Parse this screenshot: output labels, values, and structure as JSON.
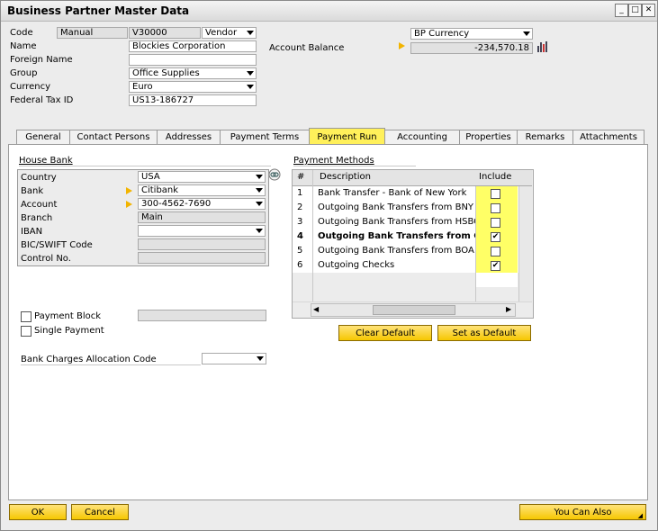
{
  "window": {
    "title": "Business Partner Master Data"
  },
  "header": {
    "code_label": "Code",
    "code_series": "Manual",
    "code_value": "V30000",
    "bp_type": "Vendor",
    "name_label": "Name",
    "name_value": "Blockies Corporation",
    "foreign_name_label": "Foreign Name",
    "foreign_name_value": "",
    "group_label": "Group",
    "group_value": "Office Supplies",
    "currency_label": "Currency",
    "currency_value": "Euro",
    "federal_tax_label": "Federal Tax ID",
    "federal_tax_value": "US13-186727",
    "balance_currency": "BP Currency",
    "account_balance_label": "Account Balance",
    "account_balance_value": "-234,570.18"
  },
  "tabs": [
    {
      "label": "General"
    },
    {
      "label": "Contact Persons"
    },
    {
      "label": "Addresses"
    },
    {
      "label": "Payment Terms"
    },
    {
      "label": "Payment Run"
    },
    {
      "label": "Accounting"
    },
    {
      "label": "Properties"
    },
    {
      "label": "Remarks"
    },
    {
      "label": "Attachments"
    }
  ],
  "house_bank": {
    "title": "House Bank",
    "country_label": "Country",
    "country_value": "USA",
    "bank_label": "Bank",
    "bank_value": "Citibank",
    "account_label": "Account",
    "account_value": "300-4562-7690",
    "branch_label": "Branch",
    "branch_value": "Main",
    "iban_label": "IBAN",
    "iban_value": "",
    "bic_label": "BIC/SWIFT Code",
    "bic_value": "",
    "control_label": "Control No.",
    "control_value": ""
  },
  "options": {
    "payment_block_label": "Payment Block",
    "single_payment_label": "Single Payment",
    "bank_charges_label": "Bank Charges Allocation Code",
    "bank_charges_value": ""
  },
  "payment_methods": {
    "title": "Payment Methods",
    "col_num": "#",
    "col_desc": "Description",
    "col_include": "Include",
    "rows": [
      {
        "num": "1",
        "desc": "Bank Transfer - Bank of New York",
        "include": false,
        "bold": false
      },
      {
        "num": "2",
        "desc": "Outgoing Bank Transfers from BNY",
        "include": false,
        "bold": false
      },
      {
        "num": "3",
        "desc": "Outgoing Bank Transfers from HSBC",
        "include": false,
        "bold": false
      },
      {
        "num": "4",
        "desc": "Outgoing Bank Transfers from CIT",
        "include": true,
        "bold": true
      },
      {
        "num": "5",
        "desc": "Outgoing Bank Transfers from BOA",
        "include": false,
        "bold": false
      },
      {
        "num": "6",
        "desc": "Outgoing Checks",
        "include": true,
        "bold": false
      }
    ],
    "clear_default_label": "Clear Default",
    "set_default_label": "Set as Default"
  },
  "footer": {
    "ok_label": "OK",
    "cancel_label": "Cancel",
    "you_can_also_label": "You Can Also"
  },
  "colors": {
    "accent": "#f6c700",
    "highlight": "#ffff66"
  }
}
